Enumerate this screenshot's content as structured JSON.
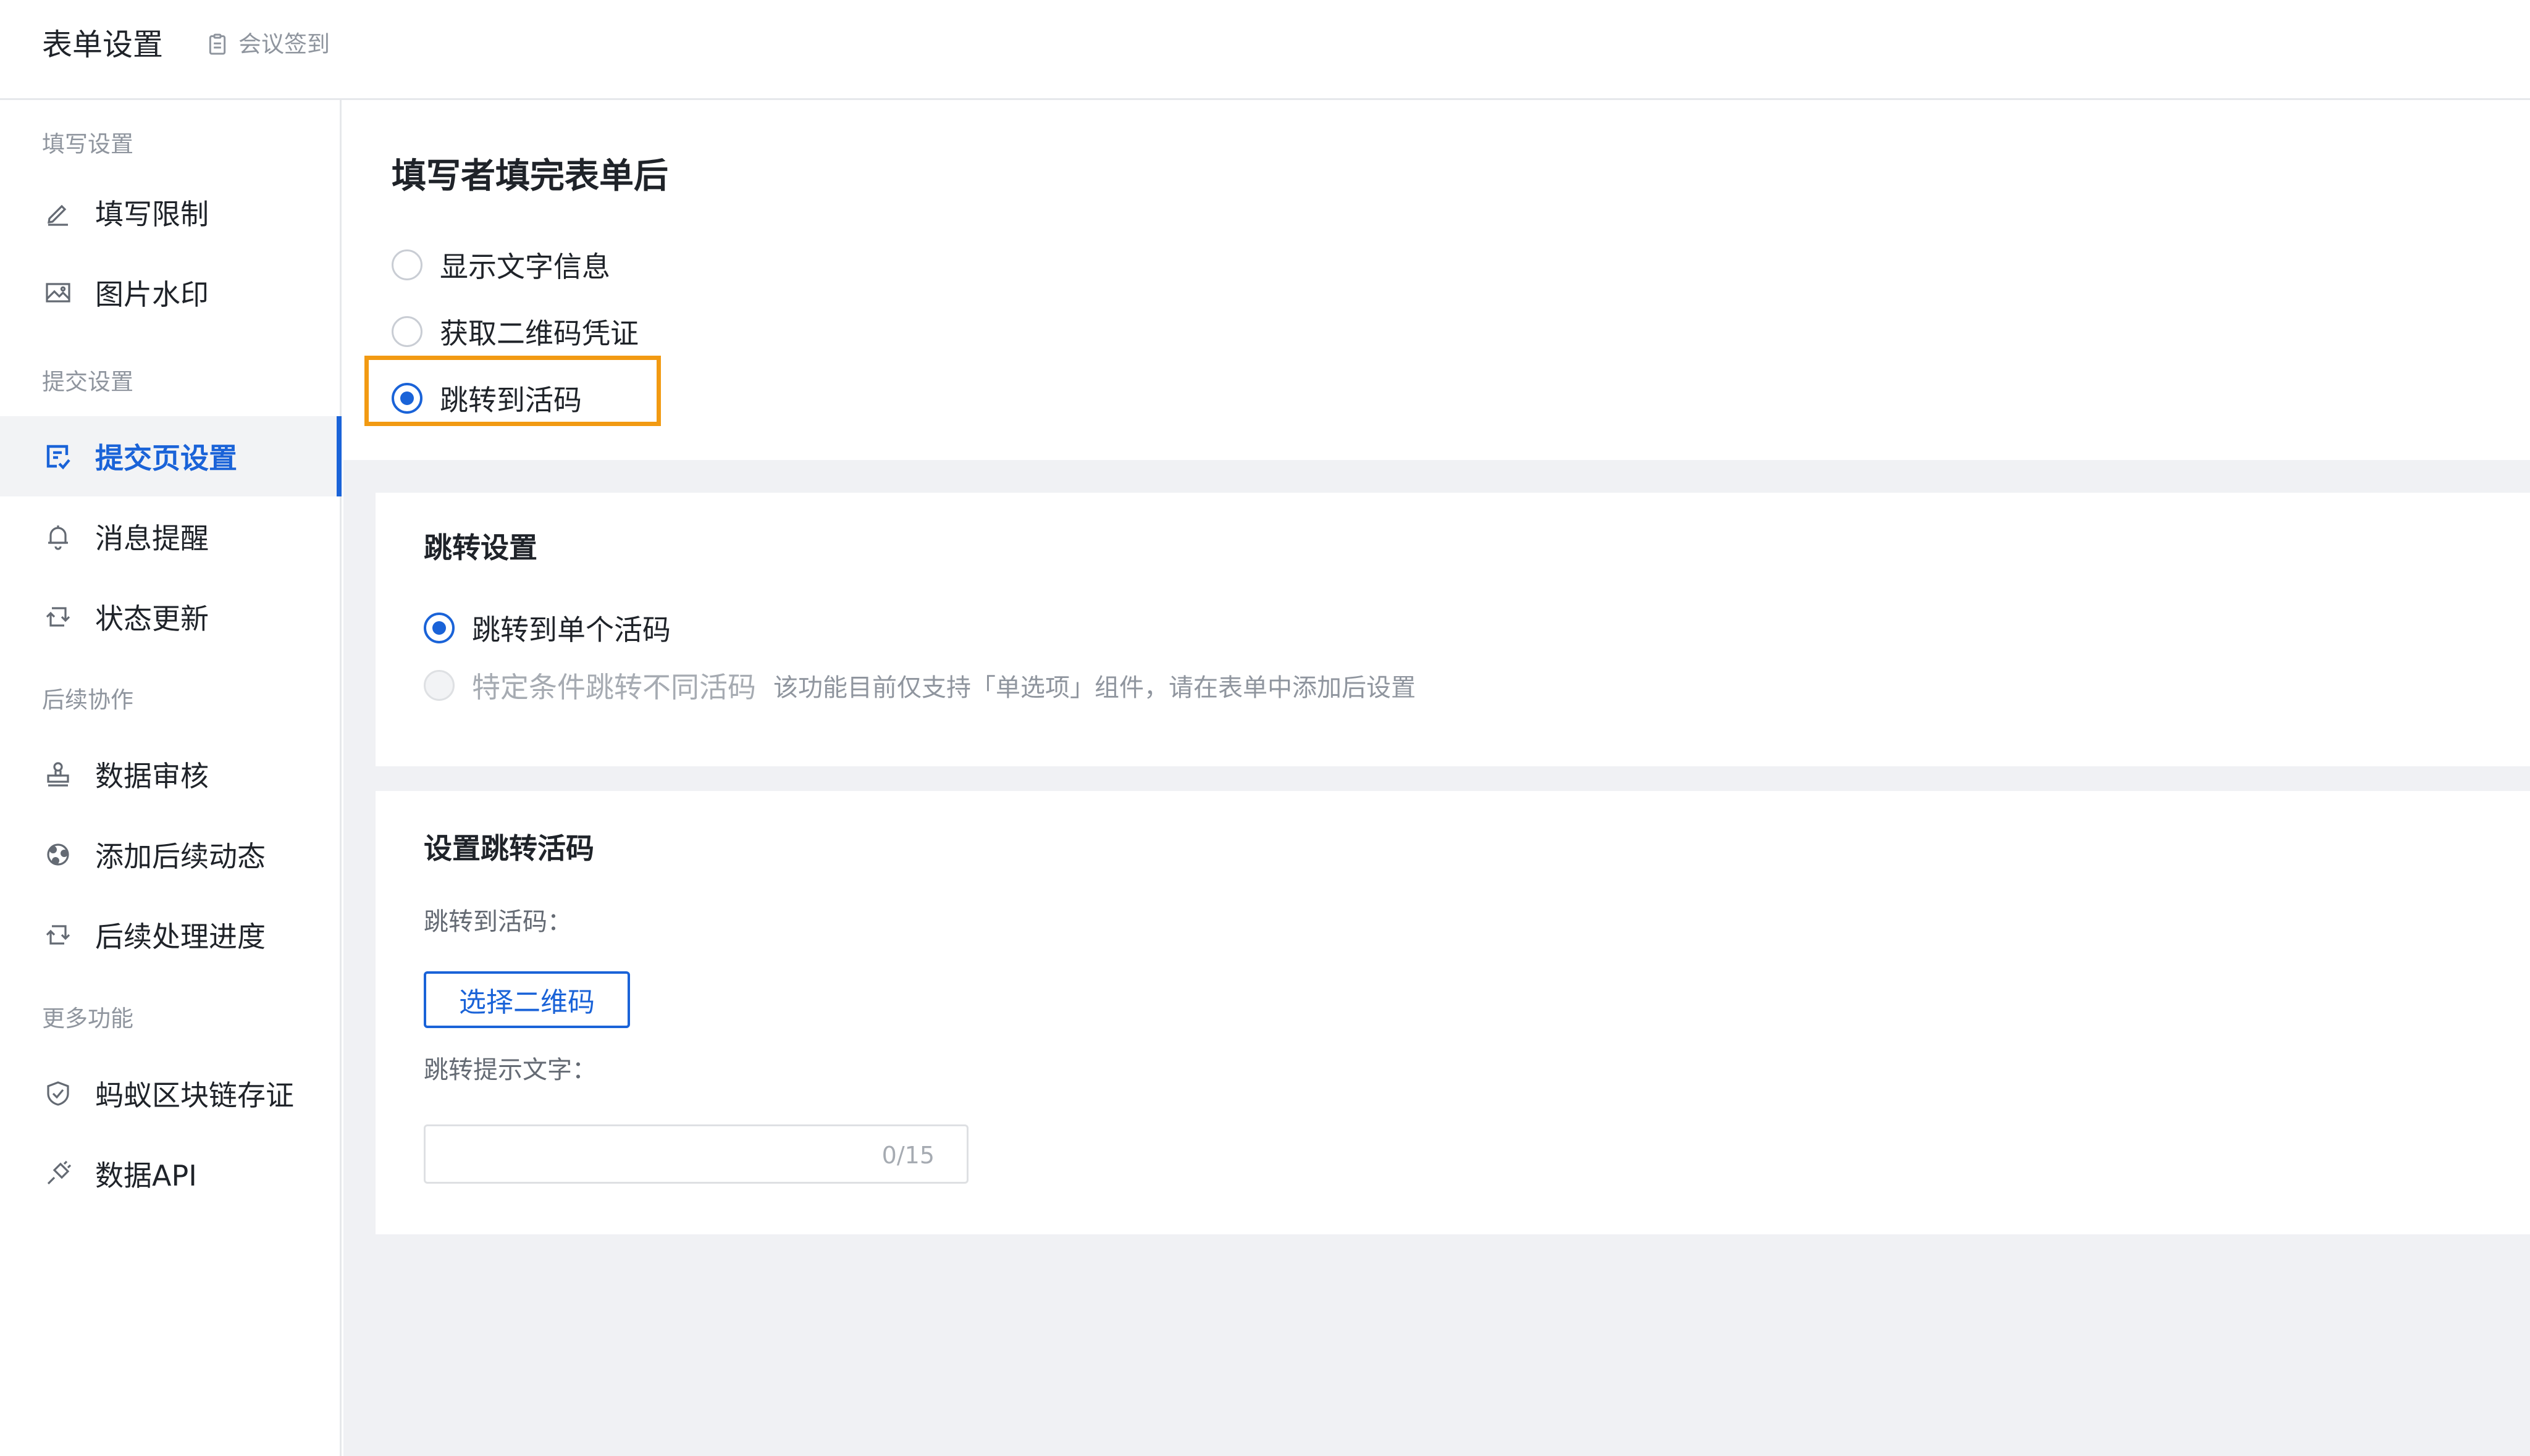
{
  "header": {
    "title": "表单设置",
    "subtitle": "会议签到",
    "subtitle_icon": "clipboard-icon"
  },
  "sidebar": {
    "groups": [
      {
        "label": "填写设置"
      },
      {
        "label": "提交设置"
      },
      {
        "label": "后续协作"
      },
      {
        "label": "更多功能"
      }
    ],
    "items": [
      {
        "label": "填写限制",
        "icon": "pen-icon"
      },
      {
        "label": "图片水印",
        "icon": "image-icon"
      },
      {
        "label": "提交页设置",
        "icon": "form-check-icon",
        "active": true
      },
      {
        "label": "消息提醒",
        "icon": "bell-icon"
      },
      {
        "label": "状态更新",
        "icon": "refresh-icon"
      },
      {
        "label": "数据审核",
        "icon": "stamp-icon"
      },
      {
        "label": "添加后续动态",
        "icon": "share-circle-icon"
      },
      {
        "label": "后续处理进度",
        "icon": "refresh-icon"
      },
      {
        "label": "蚂蚁区块链存证",
        "icon": "shield-icon"
      },
      {
        "label": "数据API",
        "icon": "plug-icon"
      }
    ],
    "accent_color": "#1a63d8"
  },
  "after_submit": {
    "title": "填写者填完表单后",
    "options": [
      {
        "label": "显示文字信息",
        "checked": false
      },
      {
        "label": "获取二维码凭证",
        "checked": false
      },
      {
        "label": "跳转到活码",
        "checked": true
      }
    ],
    "highlight_color": "#f29a12"
  },
  "jump_settings": {
    "title": "跳转设置",
    "options": [
      {
        "label": "跳转到单个活码",
        "checked": true,
        "disabled": false
      },
      {
        "label": "特定条件跳转不同活码",
        "checked": false,
        "disabled": true,
        "hint": "该功能目前仅支持「单选项」组件，请在表单中添加后设置"
      }
    ]
  },
  "set_jump_code": {
    "title": "设置跳转活码",
    "code_label": "跳转到活码：",
    "select_button": "选择二维码",
    "tip_label": "跳转提示文字：",
    "tip_value": "",
    "tip_counter": "0/15"
  }
}
